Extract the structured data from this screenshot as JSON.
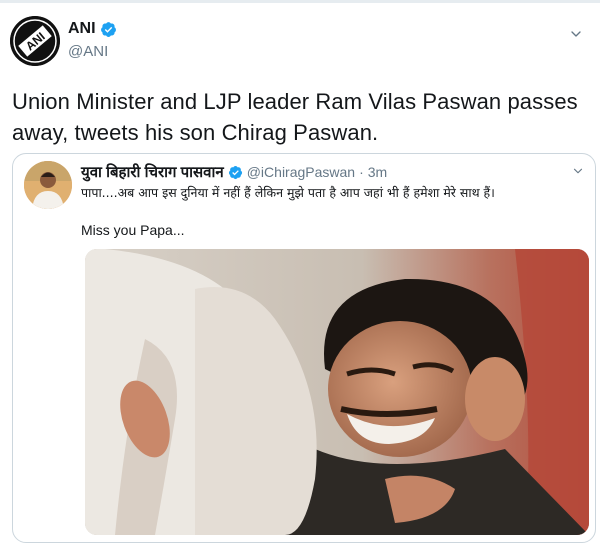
{
  "tweet": {
    "author_name": "ANI",
    "author_handle": "@ANI",
    "text": "Union Minister and LJP leader Ram Vilas Paswan passes away, tweets his son Chirag Paswan."
  },
  "avatar_logo_text": "ANI",
  "quoted": {
    "author_name": "युवा बिहारी चिराग पासवान",
    "author_handle": "@iChiragPaswan",
    "separator": "·",
    "time": "3m",
    "text_hindi": "पापा....अब आप इस दुनिया में नहीं हैं लेकिन मुझे पता है आप जहां भी हैं हमेशा मेरे साथ हैं।",
    "text_english": "Miss you Papa..."
  },
  "colors": {
    "verified_blue": "#1da1f2",
    "secondary_text": "#657786",
    "border": "#ccd6dd"
  },
  "icons": [
    "verified-icon",
    "chevron-down-icon"
  ]
}
